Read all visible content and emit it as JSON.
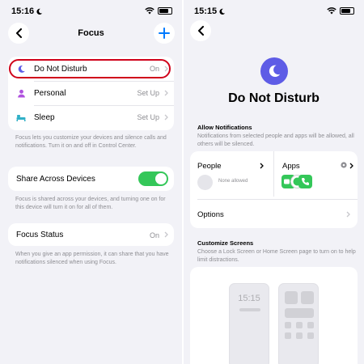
{
  "left": {
    "status": {
      "time": "15:16"
    },
    "nav": {
      "title": "Focus",
      "back_icon": "chevron-left-icon",
      "add_icon": "plus-icon"
    },
    "modes": [
      {
        "label": "Do Not Disturb",
        "value": "On",
        "icon": "moon-icon",
        "color": "#5e5ce6"
      },
      {
        "label": "Personal",
        "value": "Set Up",
        "icon": "person-icon",
        "color": "#af52de"
      },
      {
        "label": "Sleep",
        "value": "Set Up",
        "icon": "bed-icon",
        "color": "#30b0c7"
      }
    ],
    "focus_note": "Focus lets you customize your devices and silence calls and notifications. Turn it on and off in Control Center.",
    "share": {
      "label": "Share Across Devices",
      "enabled": true,
      "note": "Focus is shared across your devices, and turning one on for this device will turn it on for all of them."
    },
    "focus_status": {
      "label": "Focus Status",
      "value": "On",
      "note": "When you give an app permission, it can share that you have notifications silenced when using Focus."
    }
  },
  "right": {
    "status": {
      "time": "15:15"
    },
    "title": "Do Not Disturb",
    "allow": {
      "heading": "Allow Notifications",
      "note": "Notifications from selected people and apps will be allowed, all others will be silenced.",
      "people_label": "People",
      "people_sub": "None allowed",
      "apps_label": "Apps",
      "options_label": "Options"
    },
    "customize": {
      "heading": "Customize Screens",
      "note": "Choose a Lock Screen or Home Screen page to turn on to help limit distractions.",
      "lock_time": "15:15"
    }
  }
}
